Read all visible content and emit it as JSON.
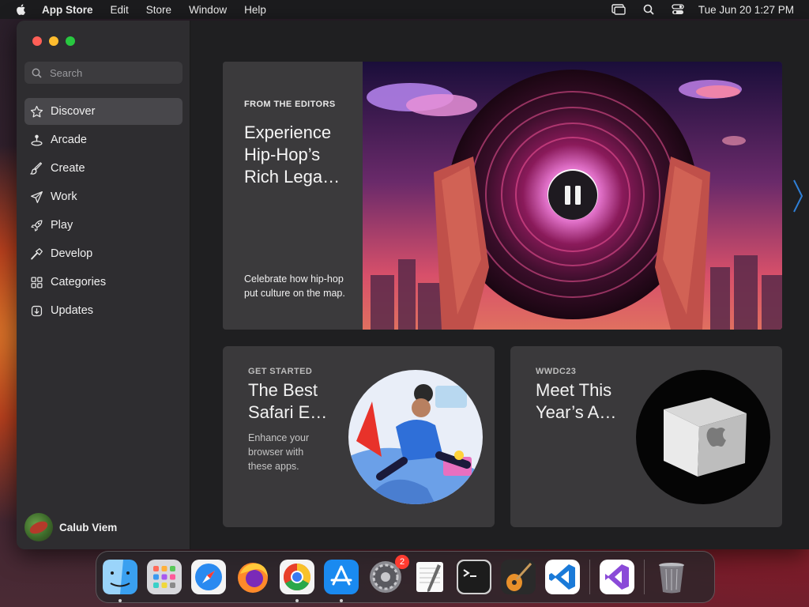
{
  "menubar": {
    "app_name": "App Store",
    "items": [
      "Edit",
      "Store",
      "Window",
      "Help"
    ],
    "clock": "Tue Jun 20  1:27 PM"
  },
  "search": {
    "placeholder": "Search"
  },
  "sidebar": {
    "items": [
      {
        "label": "Discover",
        "icon": "star-icon",
        "active": true
      },
      {
        "label": "Arcade",
        "icon": "joystick-icon"
      },
      {
        "label": "Create",
        "icon": "brush-icon"
      },
      {
        "label": "Work",
        "icon": "paperplane-icon"
      },
      {
        "label": "Play",
        "icon": "rocket-icon"
      },
      {
        "label": "Develop",
        "icon": "hammer-icon"
      },
      {
        "label": "Categories",
        "icon": "grid-icon"
      },
      {
        "label": "Updates",
        "icon": "download-icon"
      }
    ],
    "user_name": "Calub Viem"
  },
  "hero": {
    "eyebrow": "FROM THE EDITORS",
    "title": "Experience Hip-Hop’s Rich Lega…",
    "description": "Celebrate how hip-hop put culture on the map."
  },
  "cards": [
    {
      "eyebrow": "GET STARTED",
      "title": "The Best Safari E…",
      "description": "Enhance your browser with these apps."
    },
    {
      "eyebrow": "WWDC23",
      "title": "Meet This Year’s A…",
      "description": ""
    }
  ],
  "dock": {
    "apps": [
      "finder",
      "launchpad",
      "safari",
      "firefox",
      "chrome",
      "app-store",
      "system-settings",
      "textedit",
      "terminal",
      "garageband",
      "vscode",
      "visual-studio",
      "trash"
    ],
    "system_settings_badge": "2"
  },
  "colors": {
    "accent": "#0a84ff",
    "sidebar_bg": "#2e2d30",
    "active_item": "#48474b",
    "badge": "#ff3b30"
  }
}
